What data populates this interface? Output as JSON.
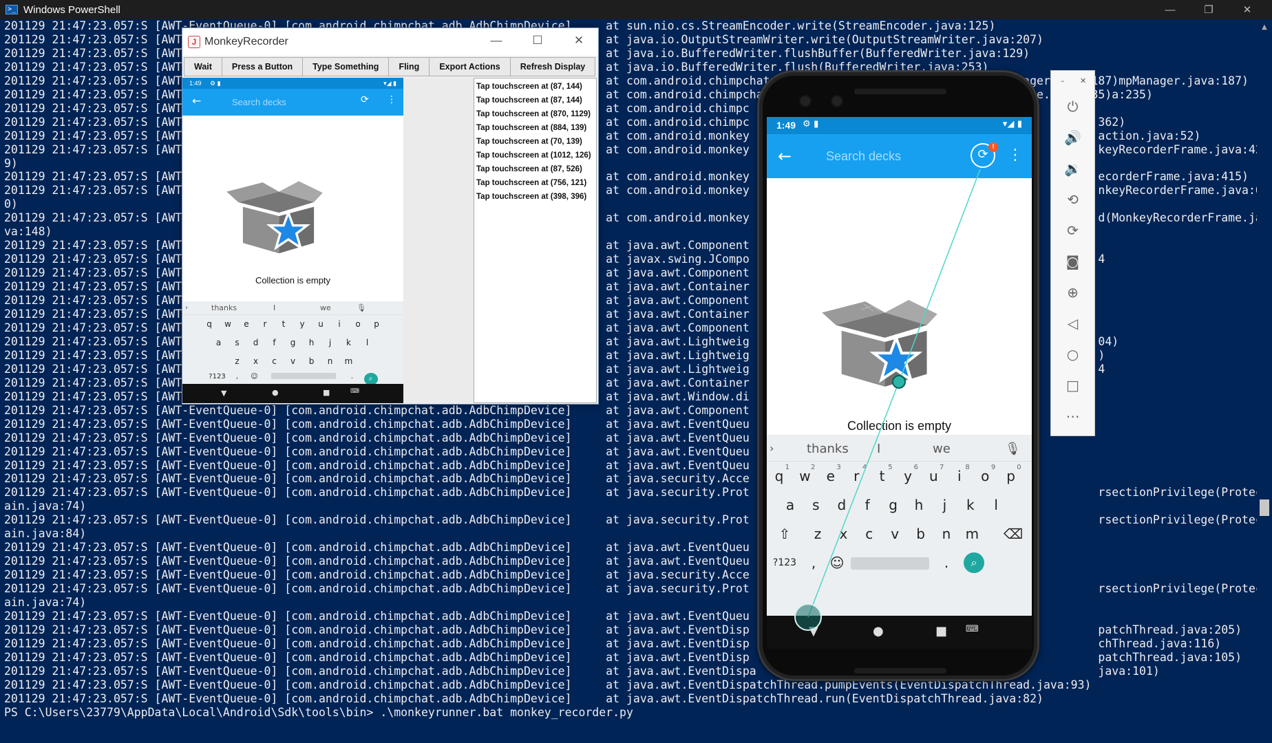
{
  "powershell": {
    "title": "Windows PowerShell",
    "lines": [
      "201129 21:47:23.057:S [AWT-EventQueue-0] [com.android.chimpchat.adb.AdbChimpDevice]     at sun.nio.cs.StreamEncoder.write(StreamEncoder.java:125)",
      "201129 21:47:23.057:S [AWT-EventQueue-0] [com.android.chimpchat.adb.AdbChimpDevice]     at java.io.OutputStreamWriter.write(OutputStreamWriter.java:207)",
      "201129 21:47:23.057:S [AWT-EventQueue-0] [com.android.chimpchat.adb.AdbChimpDevice]     at java.io.BufferedWriter.flushBuffer(BufferedWriter.java:129)",
      "201129 21:47:23.057:S [AWT-EventQueue-0] [com.android.chimpchat.adb.AdbChimpDevice]     at java.io.BufferedWriter.flush(BufferedWriter.java:253)",
      "201129 21:47:23.057:S [AWT-EventQueue-0] [com.android.chimpchat.adb.AdbChimpDevice]     at com.android.chimpchat.adb.AdbChimpDevice.touch(AdbChimpManager.java:187)mpManager.java:187)",
      "201129 21:47:23.057:S [AWT-EventQueue-0] [com.android.chimpchat.adb.AdbChimpDevice]     at com.android.chimpchat.adb.AdbChimpDevice.touch(AdbChimpDevice.java:235)a:235)",
      "201129 21:47:23.057:S [AWT-EventQueue-0] [com.android.chimpchat.adb.AdbChimpDevice]     at com.android.chimpc",
      "201129 21:47:23.057:S [AWT-EventQueue-0] [com.android.chimpchat.adb.AdbChimpDevice]     at com.android.chimpc                                                   362)",
      "201129 21:47:23.057:S [AWT-EventQueue-0] [com.android.chimpchat.adb.AdbChimpDevice]     at com.android.monkey                                                   action.java:52)",
      "201129 21:47:23.057:S [AWT-EventQueue-0] [com.android.chimpchat.adb.AdbChimpDevice]     at com.android.monkey                                                   keyRecorderFrame.java:42",
      "9)",
      "201129 21:47:23.057:S [AWT-EventQueue-0] [com.android.chimpchat.adb.AdbChimpDevice]     at com.android.monkey                                                   ecorderFrame.java:415)",
      "201129 21:47:23.057:S [AWT-EventQueue-0] [com.android.chimpchat.adb.AdbChimpDevice]     at com.android.monkey                                                   nkeyRecorderFrame.java:6",
      "0)",
      "201129 21:47:23.057:S [AWT-EventQueue-0] [com.android.chimpchat.adb.AdbChimpDevice]     at com.android.monkey                                                   d(MonkeyRecorderFrame.ja",
      "va:148)",
      "201129 21:47:23.057:S [AWT-EventQueue-0] [com.android.chimpchat.adb.AdbChimpDevice]     at java.awt.Component",
      "201129 21:47:23.057:S [AWT-EventQueue-0] [com.android.chimpchat.adb.AdbChimpDevice]     at javax.swing.JCompo                                                   4",
      "201129 21:47:23.057:S [AWT-EventQueue-0] [com.android.chimpchat.adb.AdbChimpDevice]     at java.awt.Component",
      "201129 21:47:23.057:S [AWT-EventQueue-0] [com.android.chimpchat.adb.AdbChimpDevice]     at java.awt.Container",
      "201129 21:47:23.057:S [AWT-EventQueue-0] [com.android.chimpchat.adb.AdbChimpDevice]     at java.awt.Component",
      "201129 21:47:23.057:S [AWT-EventQueue-0] [com.android.chimpchat.adb.AdbChimpDevice]     at java.awt.Container",
      "201129 21:47:23.057:S [AWT-EventQueue-0] [com.android.chimpchat.adb.AdbChimpDevice]     at java.awt.Component",
      "201129 21:47:23.057:S [AWT-EventQueue-0] [com.android.chimpchat.adb.AdbChimpDevice]     at java.awt.Lightweig                                                   04)",
      "201129 21:47:23.057:S [AWT-EventQueue-0] [com.android.chimpchat.adb.AdbChimpDevice]     at java.awt.Lightweig                                                   )",
      "201129 21:47:23.057:S [AWT-EventQueue-0] [com.android.chimpchat.adb.AdbChimpDevice]     at java.awt.Lightweig                                                   4",
      "201129 21:47:23.057:S [AWT-EventQueue-0] [com.android.chimpchat.adb.AdbChimpDevice]     at java.awt.Container",
      "201129 21:47:23.057:S [AWT-EventQueue-0] [com.android.chimpchat.adb.AdbChimpDevice]     at java.awt.Window.di",
      "201129 21:47:23.057:S [AWT-EventQueue-0] [com.android.chimpchat.adb.AdbChimpDevice]     at java.awt.Component",
      "201129 21:47:23.057:S [AWT-EventQueue-0] [com.android.chimpchat.adb.AdbChimpDevice]     at java.awt.EventQueu",
      "201129 21:47:23.057:S [AWT-EventQueue-0] [com.android.chimpchat.adb.AdbChimpDevice]     at java.awt.EventQueu",
      "201129 21:47:23.057:S [AWT-EventQueue-0] [com.android.chimpchat.adb.AdbChimpDevice]     at java.awt.EventQueu",
      "201129 21:47:23.057:S [AWT-EventQueue-0] [com.android.chimpchat.adb.AdbChimpDevice]     at java.awt.EventQueu",
      "201129 21:47:23.057:S [AWT-EventQueue-0] [com.android.chimpchat.adb.AdbChimpDevice]     at java.security.Acce",
      "201129 21:47:23.057:S [AWT-EventQueue-0] [com.android.chimpchat.adb.AdbChimpDevice]     at java.security.Prot                                                   rsectionPrivilege(ProtectionDom",
      "ain.java:74)",
      "201129 21:47:23.057:S [AWT-EventQueue-0] [com.android.chimpchat.adb.AdbChimpDevice]     at java.security.Prot                                                   rsectionPrivilege(ProtectionDom",
      "ain.java:84)",
      "201129 21:47:23.057:S [AWT-EventQueue-0] [com.android.chimpchat.adb.AdbChimpDevice]     at java.awt.EventQueu",
      "201129 21:47:23.057:S [AWT-EventQueue-0] [com.android.chimpchat.adb.AdbChimpDevice]     at java.awt.EventQueu",
      "201129 21:47:23.057:S [AWT-EventQueue-0] [com.android.chimpchat.adb.AdbChimpDevice]     at java.security.Acce",
      "201129 21:47:23.057:S [AWT-EventQueue-0] [com.android.chimpchat.adb.AdbChimpDevice]     at java.security.Prot                                                   rsectionPrivilege(ProtectionDom",
      "ain.java:74)",
      "201129 21:47:23.057:S [AWT-EventQueue-0] [com.android.chimpchat.adb.AdbChimpDevice]     at java.awt.EventQueu",
      "201129 21:47:23.057:S [AWT-EventQueue-0] [com.android.chimpchat.adb.AdbChimpDevice]     at java.awt.EventDisp                                                   patchThread.java:205)",
      "201129 21:47:23.057:S [AWT-EventQueue-0] [com.android.chimpchat.adb.AdbChimpDevice]     at java.awt.EventDisp                                                   chThread.java:116)",
      "201129 21:47:23.057:S [AWT-EventQueue-0] [com.android.chimpchat.adb.AdbChimpDevice]     at java.awt.EventDisp                                                   patchThread.java:105)",
      "201129 21:47:23.057:S [AWT-EventQueue-0] [com.android.chimpchat.adb.AdbChimpDevice]     at java.awt.EventDispa                                                  java:101)",
      "201129 21:47:23.057:S [AWT-EventQueue-0] [com.android.chimpchat.adb.AdbChimpDevice]     at java.awt.EventDispatchThread.pumpEvents(EventDispatchThread.java:93)",
      "201129 21:47:23.057:S [AWT-EventQueue-0] [com.android.chimpchat.adb.AdbChimpDevice]     at java.awt.EventDispatchThread.run(EventDispatchThread.java:82)",
      "PS C:\\Users\\23779\\AppData\\Local\\Android\\Sdk\\tools\\bin> .\\monkeyrunner.bat monkey_recorder.py"
    ]
  },
  "recorder": {
    "title": "MonkeyRecorder",
    "buttons": [
      "Wait",
      "Press a Button",
      "Type Something",
      "Fling",
      "Export Actions",
      "Refresh Display"
    ],
    "actions": [
      "Tap touchscreen at (87, 144)",
      "Tap touchscreen at (87, 144)",
      "Tap touchscreen at (870, 1129)",
      "Tap touchscreen at (884, 139)",
      "Tap touchscreen at (70, 139)",
      "Tap touchscreen at (1012, 126)",
      "Tap touchscreen at (87, 526)",
      "Tap touchscreen at (756, 121)",
      "Tap touchscreen at (398, 396)"
    ]
  },
  "device": {
    "time": "1:49",
    "search_placeholder": "Search decks",
    "empty_message": "Collection is empty",
    "badge": "!",
    "suggestions": [
      "thanks",
      "I",
      "we"
    ],
    "keys_row1": [
      "q",
      "w",
      "e",
      "r",
      "t",
      "y",
      "u",
      "i",
      "o",
      "p"
    ],
    "keys_row1_digits": [
      "1",
      "2",
      "3",
      "4",
      "5",
      "6",
      "7",
      "8",
      "9",
      "0"
    ],
    "keys_row2": [
      "a",
      "s",
      "d",
      "f",
      "g",
      "h",
      "j",
      "k",
      "l"
    ],
    "keys_row3": [
      "z",
      "x",
      "c",
      "v",
      "b",
      "n",
      "m"
    ],
    "symbols_key": "?123",
    "comma_key": ",",
    "period_key": ".",
    "colors": {
      "statusbar": "#0a88d4",
      "appbar": "#17a0f0",
      "accent": "#1fa8a0",
      "console_bg": "#012456"
    }
  }
}
